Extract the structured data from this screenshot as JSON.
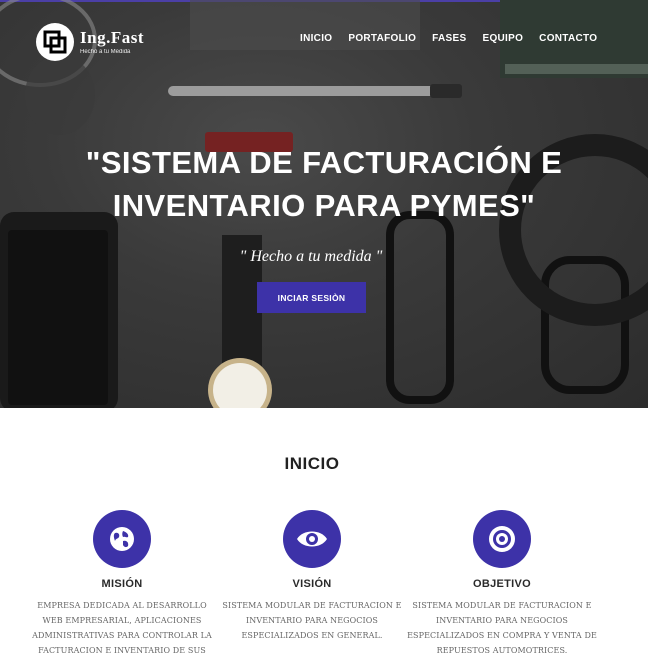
{
  "brand": {
    "name": "Ing.Fast",
    "tagline": "Hecho a tu Medida"
  },
  "nav": {
    "items": [
      "INICIO",
      "PORTAFOLIO",
      "FASES",
      "EQUIPO",
      "CONTACTO"
    ]
  },
  "hero": {
    "title": "\"SISTEMA DE FACTURACIÓN E INVENTARIO PARA PYMES\"",
    "subtitle": "\" Hecho a tu medida \"",
    "button_label": "INCIAR SESIÒN"
  },
  "section": {
    "title": "INICIO"
  },
  "features": [
    {
      "icon": "globe-icon",
      "title": "MISIÓN",
      "description": "EMPRESA DEDICADA AL DESARROLLO WEB EMPRESARIAL, APLICACIONES ADMINISTRATIVAS PARA CONTROLAR LA FACTURACION E INVENTARIO DE SUS"
    },
    {
      "icon": "eye-icon",
      "title": "VISIÓN",
      "description": "SISTEMA MODULAR DE FACTURACION E INVENTARIO PARA NEGOCIOS ESPECIALIZADOS EN GENERAL."
    },
    {
      "icon": "target-icon",
      "title": "OBJETIVO",
      "description": "SISTEMA MODULAR DE FACTURACION E INVENTARIO PARA NEGOCIOS ESPECIALIZADOS EN COMPRA Y VENTA DE REPUESTOS AUTOMOTRICES."
    }
  ],
  "colors": {
    "accent": "#3d32a8",
    "hero_background": "#3a3a3a"
  }
}
